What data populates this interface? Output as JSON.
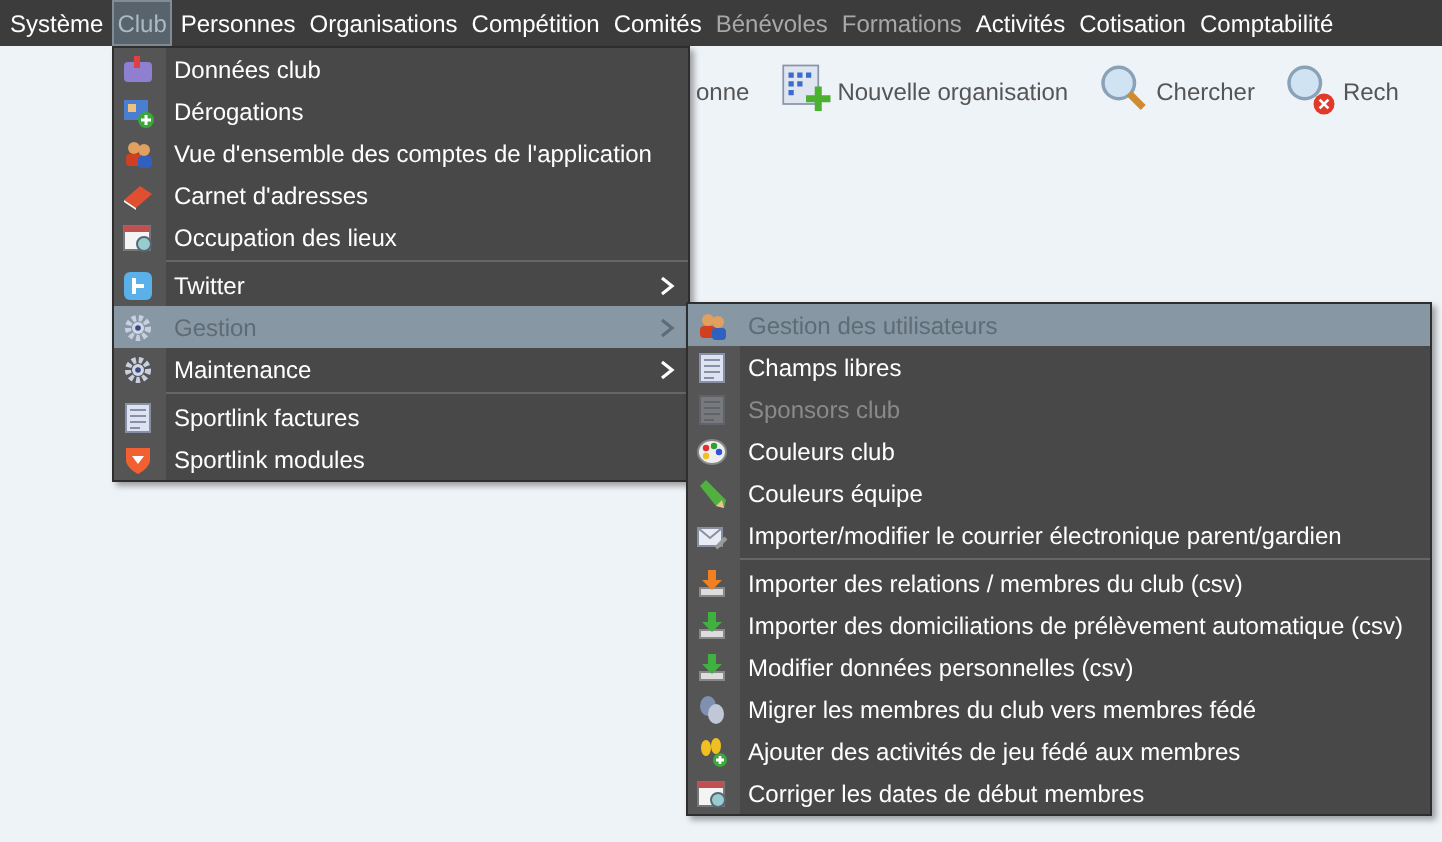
{
  "menubar": [
    {
      "label": "Système",
      "selected": false,
      "disabled": false
    },
    {
      "label": "Club",
      "selected": true,
      "disabled": false
    },
    {
      "label": "Personnes",
      "selected": false,
      "disabled": false
    },
    {
      "label": "Organisations",
      "selected": false,
      "disabled": false
    },
    {
      "label": "Compétition",
      "selected": false,
      "disabled": false
    },
    {
      "label": "Comités",
      "selected": false,
      "disabled": false
    },
    {
      "label": "Bénévoles",
      "selected": false,
      "disabled": true
    },
    {
      "label": "Formations",
      "selected": false,
      "disabled": true
    },
    {
      "label": "Activités",
      "selected": false,
      "disabled": false
    },
    {
      "label": "Cotisation",
      "selected": false,
      "disabled": false
    },
    {
      "label": "Comptabilité",
      "selected": false,
      "disabled": false
    }
  ],
  "toolbar": [
    {
      "label": "onne"
    },
    {
      "label": "Nouvelle organisation"
    },
    {
      "label": "Chercher"
    },
    {
      "label": "Rech"
    }
  ],
  "club_menu": {
    "groups": [
      [
        {
          "label": "Données club",
          "selected": false,
          "has_submenu": false
        },
        {
          "label": "Dérogations",
          "selected": false,
          "has_submenu": false
        },
        {
          "label": "Vue d'ensemble des comptes de l'application",
          "selected": false,
          "has_submenu": false
        },
        {
          "label": "Carnet d'adresses",
          "selected": false,
          "has_submenu": false
        },
        {
          "label": "Occupation des lieux",
          "selected": false,
          "has_submenu": false
        }
      ],
      [
        {
          "label": "Twitter",
          "selected": false,
          "has_submenu": true
        },
        {
          "label": "Gestion",
          "selected": true,
          "has_submenu": true
        },
        {
          "label": "Maintenance",
          "selected": false,
          "has_submenu": true
        }
      ],
      [
        {
          "label": "Sportlink factures",
          "selected": false,
          "has_submenu": false
        },
        {
          "label": "Sportlink modules",
          "selected": false,
          "has_submenu": false
        }
      ]
    ]
  },
  "gestion_submenu": {
    "groups": [
      [
        {
          "label": "Gestion des utilisateurs",
          "selected": true,
          "disabled": false
        },
        {
          "label": "Champs libres",
          "selected": false,
          "disabled": false
        },
        {
          "label": "Sponsors club",
          "selected": false,
          "disabled": true
        },
        {
          "label": "Couleurs club",
          "selected": false,
          "disabled": false
        },
        {
          "label": "Couleurs équipe",
          "selected": false,
          "disabled": false
        },
        {
          "label": "Importer/modifier le courrier électronique parent/gardien",
          "selected": false,
          "disabled": false
        }
      ],
      [
        {
          "label": "Importer des relations / membres du club (csv)",
          "selected": false,
          "disabled": false
        },
        {
          "label": "Importer des domiciliations de prélèvement automatique (csv)",
          "selected": false,
          "disabled": false
        },
        {
          "label": "Modifier données personnelles (csv)",
          "selected": false,
          "disabled": false
        },
        {
          "label": "Migrer les membres du club vers membres fédé",
          "selected": false,
          "disabled": false
        },
        {
          "label": "Ajouter des activités de jeu fédé aux membres",
          "selected": false,
          "disabled": false
        },
        {
          "label": "Corriger les dates de début membres",
          "selected": false,
          "disabled": false
        }
      ]
    ]
  }
}
